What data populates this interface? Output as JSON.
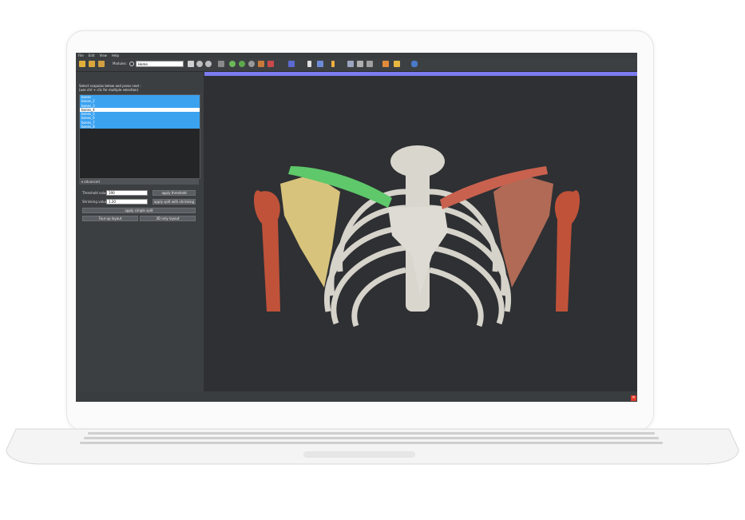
{
  "menu": [
    "File",
    "Edit",
    "View",
    "Help"
  ],
  "toolbar": {
    "modules_label": "Modules:",
    "module_selected": "Home"
  },
  "panel": {
    "instruction_line1": "Select scapulas below and press next :",
    "instruction_line2": "(use ctrl + clic for multiple selection)",
    "items": [
      {
        "label": "bones",
        "selected": true
      },
      {
        "label": "bones_2",
        "selected": true
      },
      {
        "label": "bones_3",
        "selected": true
      },
      {
        "label": "bones_4",
        "selected": false
      },
      {
        "label": "bones_5",
        "selected": true
      },
      {
        "label": "bones_6",
        "selected": true
      },
      {
        "label": "bones_7",
        "selected": true
      },
      {
        "label": "bones_8",
        "selected": true
      }
    ],
    "advanced_label": "advanced",
    "threshold_label": "Threshold value:",
    "threshold_value": "190",
    "apply_threshold": "apply threshold",
    "shrinking_label": "Shrinking value:",
    "shrinking_value": "1.20",
    "apply_split_shrinking": "apply split with shrinking",
    "apply_simple_split": "apply simple split",
    "four_up_layout": "Four-up layout",
    "three_d_layout": "3D only layout"
  },
  "colors": {
    "accent": "#3ba2f0",
    "viewport_bar": "#7c7cf0",
    "clavicle_left": "#5ec86a",
    "clavicle_right": "#c9614f",
    "humerus": "#c0523a",
    "scapula_left": "#d8c37c",
    "scapula_right": "#b06a55",
    "bone": "#d9d6ce"
  }
}
